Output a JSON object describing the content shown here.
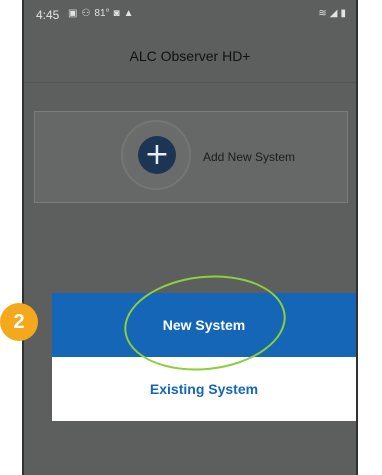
{
  "status_bar": {
    "time": "4:45",
    "left_icons": [
      "gallery-icon",
      "network-icon",
      "temperature-icon",
      "notification-icon",
      "cloud-icon"
    ],
    "temperature": "81°",
    "right_icons": [
      "wifi-icon",
      "signal-icon",
      "battery-icon"
    ]
  },
  "app_bar": {
    "title": "ALC Observer HD+"
  },
  "add_system": {
    "label": "Add New System",
    "icon": "plus-icon"
  },
  "step": {
    "number": "2",
    "color": "#f4a81c"
  },
  "dialog": {
    "new_system_label": "New System",
    "existing_system_label": "Existing System"
  },
  "colors": {
    "accent_blue": "#1566b7",
    "highlight_green": "#8ccf3a",
    "screen_gray": "#5d5f5f"
  }
}
